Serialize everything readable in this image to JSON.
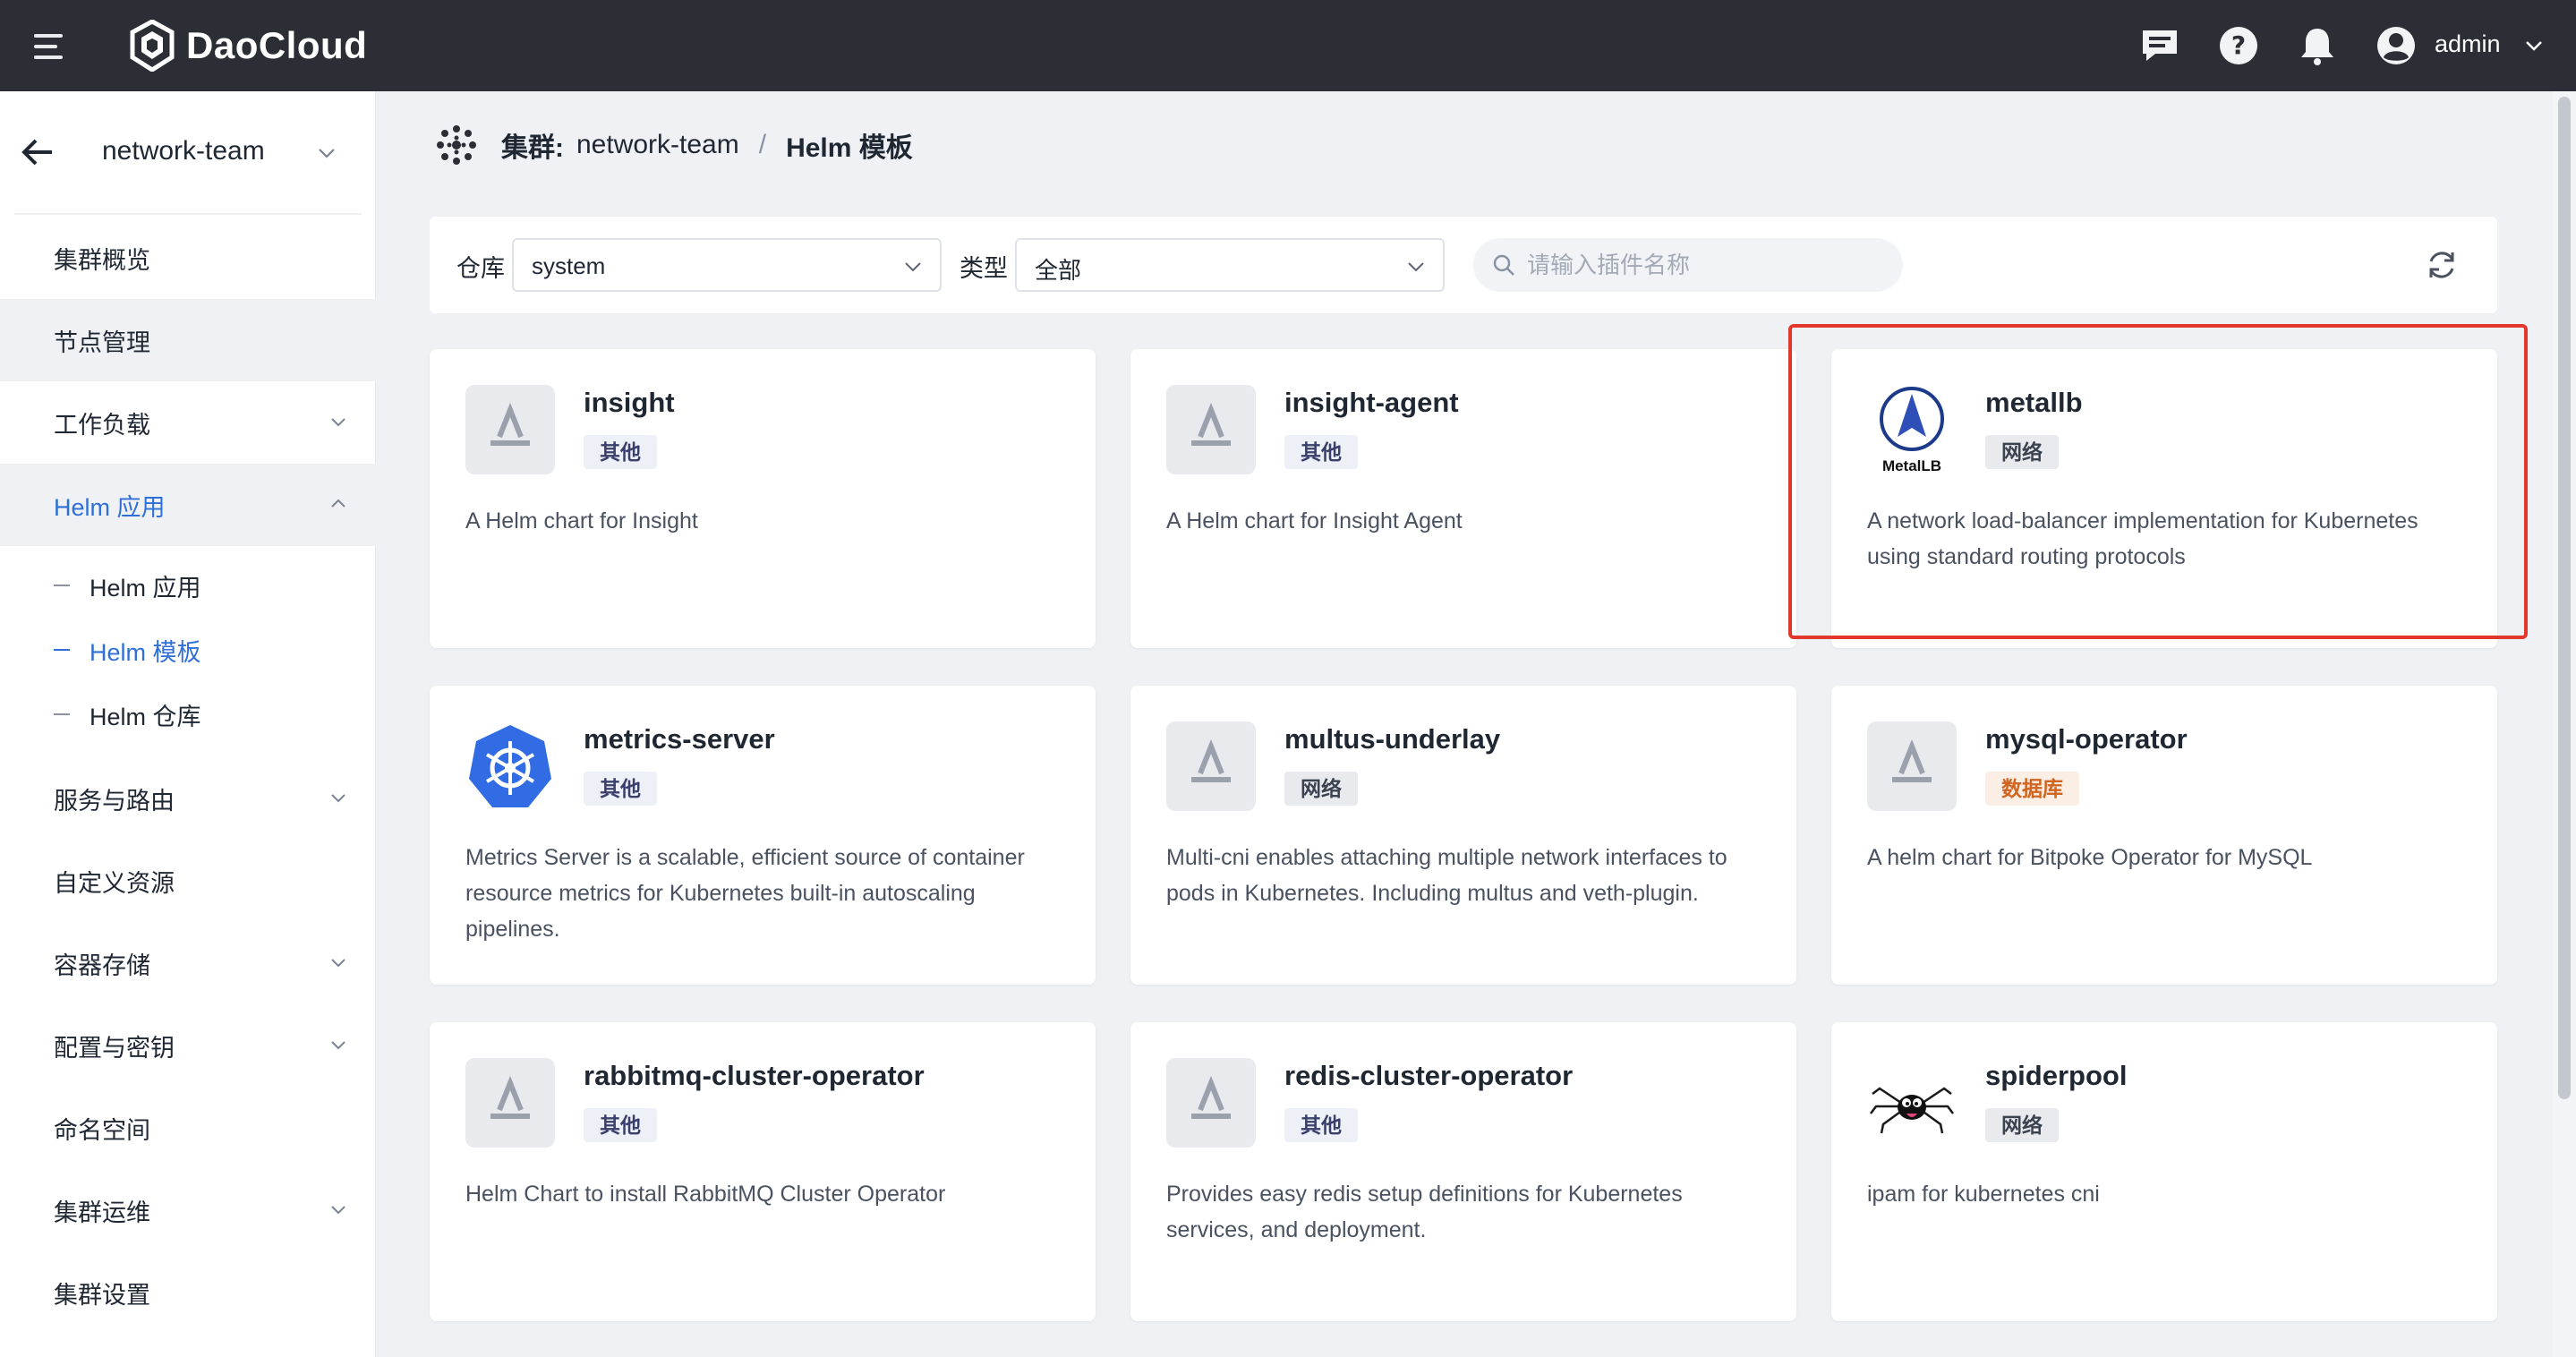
{
  "app": {
    "brand": "DaoCloud"
  },
  "topbar": {
    "username": "admin"
  },
  "sidebar": {
    "cluster": "network-team",
    "items": [
      {
        "label": "集群概览"
      },
      {
        "label": "节点管理"
      },
      {
        "label": "工作负载"
      },
      {
        "label": "Helm 应用"
      },
      {
        "label": "服务与路由"
      },
      {
        "label": "自定义资源"
      },
      {
        "label": "容器存储"
      },
      {
        "label": "配置与密钥"
      },
      {
        "label": "命名空间"
      },
      {
        "label": "集群运维"
      },
      {
        "label": "集群设置"
      }
    ],
    "helm_sub": [
      {
        "label": "Helm 应用"
      },
      {
        "label": "Helm 模板"
      },
      {
        "label": "Helm 仓库"
      }
    ]
  },
  "breadcrumb": {
    "prefix": "集群:",
    "cluster": "network-team",
    "separator": "/",
    "current": "Helm 模板"
  },
  "filters": {
    "repo_label": "仓库",
    "repo_value": "system",
    "type_label": "类型",
    "type_value": "全部",
    "search_placeholder": "请输入插件名称"
  },
  "cards": [
    {
      "title": "insight",
      "tag": "其他",
      "desc": "A Helm chart for Insight"
    },
    {
      "title": "insight-agent",
      "tag": "其他",
      "desc": "A Helm chart for Insight Agent"
    },
    {
      "title": "metallb",
      "tag": "网络",
      "desc": "A network load-balancer implementation for Kubernetes using standard routing protocols",
      "logo_text": "MetalLB"
    },
    {
      "title": "metrics-server",
      "tag": "其他",
      "desc": "Metrics Server is a scalable, efficient source of container resource metrics for Kubernetes built-in autoscaling pipelines."
    },
    {
      "title": "multus-underlay",
      "tag": "网络",
      "desc": "Multi-cni enables attaching multiple network interfaces to pods in Kubernetes. Including multus and veth-plugin."
    },
    {
      "title": "mysql-operator",
      "tag": "数据库",
      "desc": "A helm chart for Bitpoke Operator for MySQL"
    },
    {
      "title": "rabbitmq-cluster-operator",
      "tag": "其他",
      "desc": "Helm Chart to install RabbitMQ Cluster Operator"
    },
    {
      "title": "redis-cluster-operator",
      "tag": "其他",
      "desc": "Provides easy redis setup definitions for Kubernetes services, and deployment."
    },
    {
      "title": "spiderpool",
      "tag": "网络",
      "desc": "ipam for kubernetes cni"
    }
  ],
  "colors": {
    "topbar": "#2b2e34",
    "accent": "#2f6fd8",
    "highlight": "#e4372b",
    "tag_db": "#d1641f"
  },
  "icons": [
    "menu-icon",
    "daocloud-logo-icon",
    "message-icon",
    "help-icon",
    "bell-icon",
    "user-avatar-icon",
    "chevron-down-icon",
    "back-arrow-icon",
    "cluster-icon",
    "search-icon",
    "refresh-icon",
    "helm-chart-icon",
    "metallb-logo-icon",
    "kubernetes-logo-icon",
    "spider-logo-icon"
  ]
}
